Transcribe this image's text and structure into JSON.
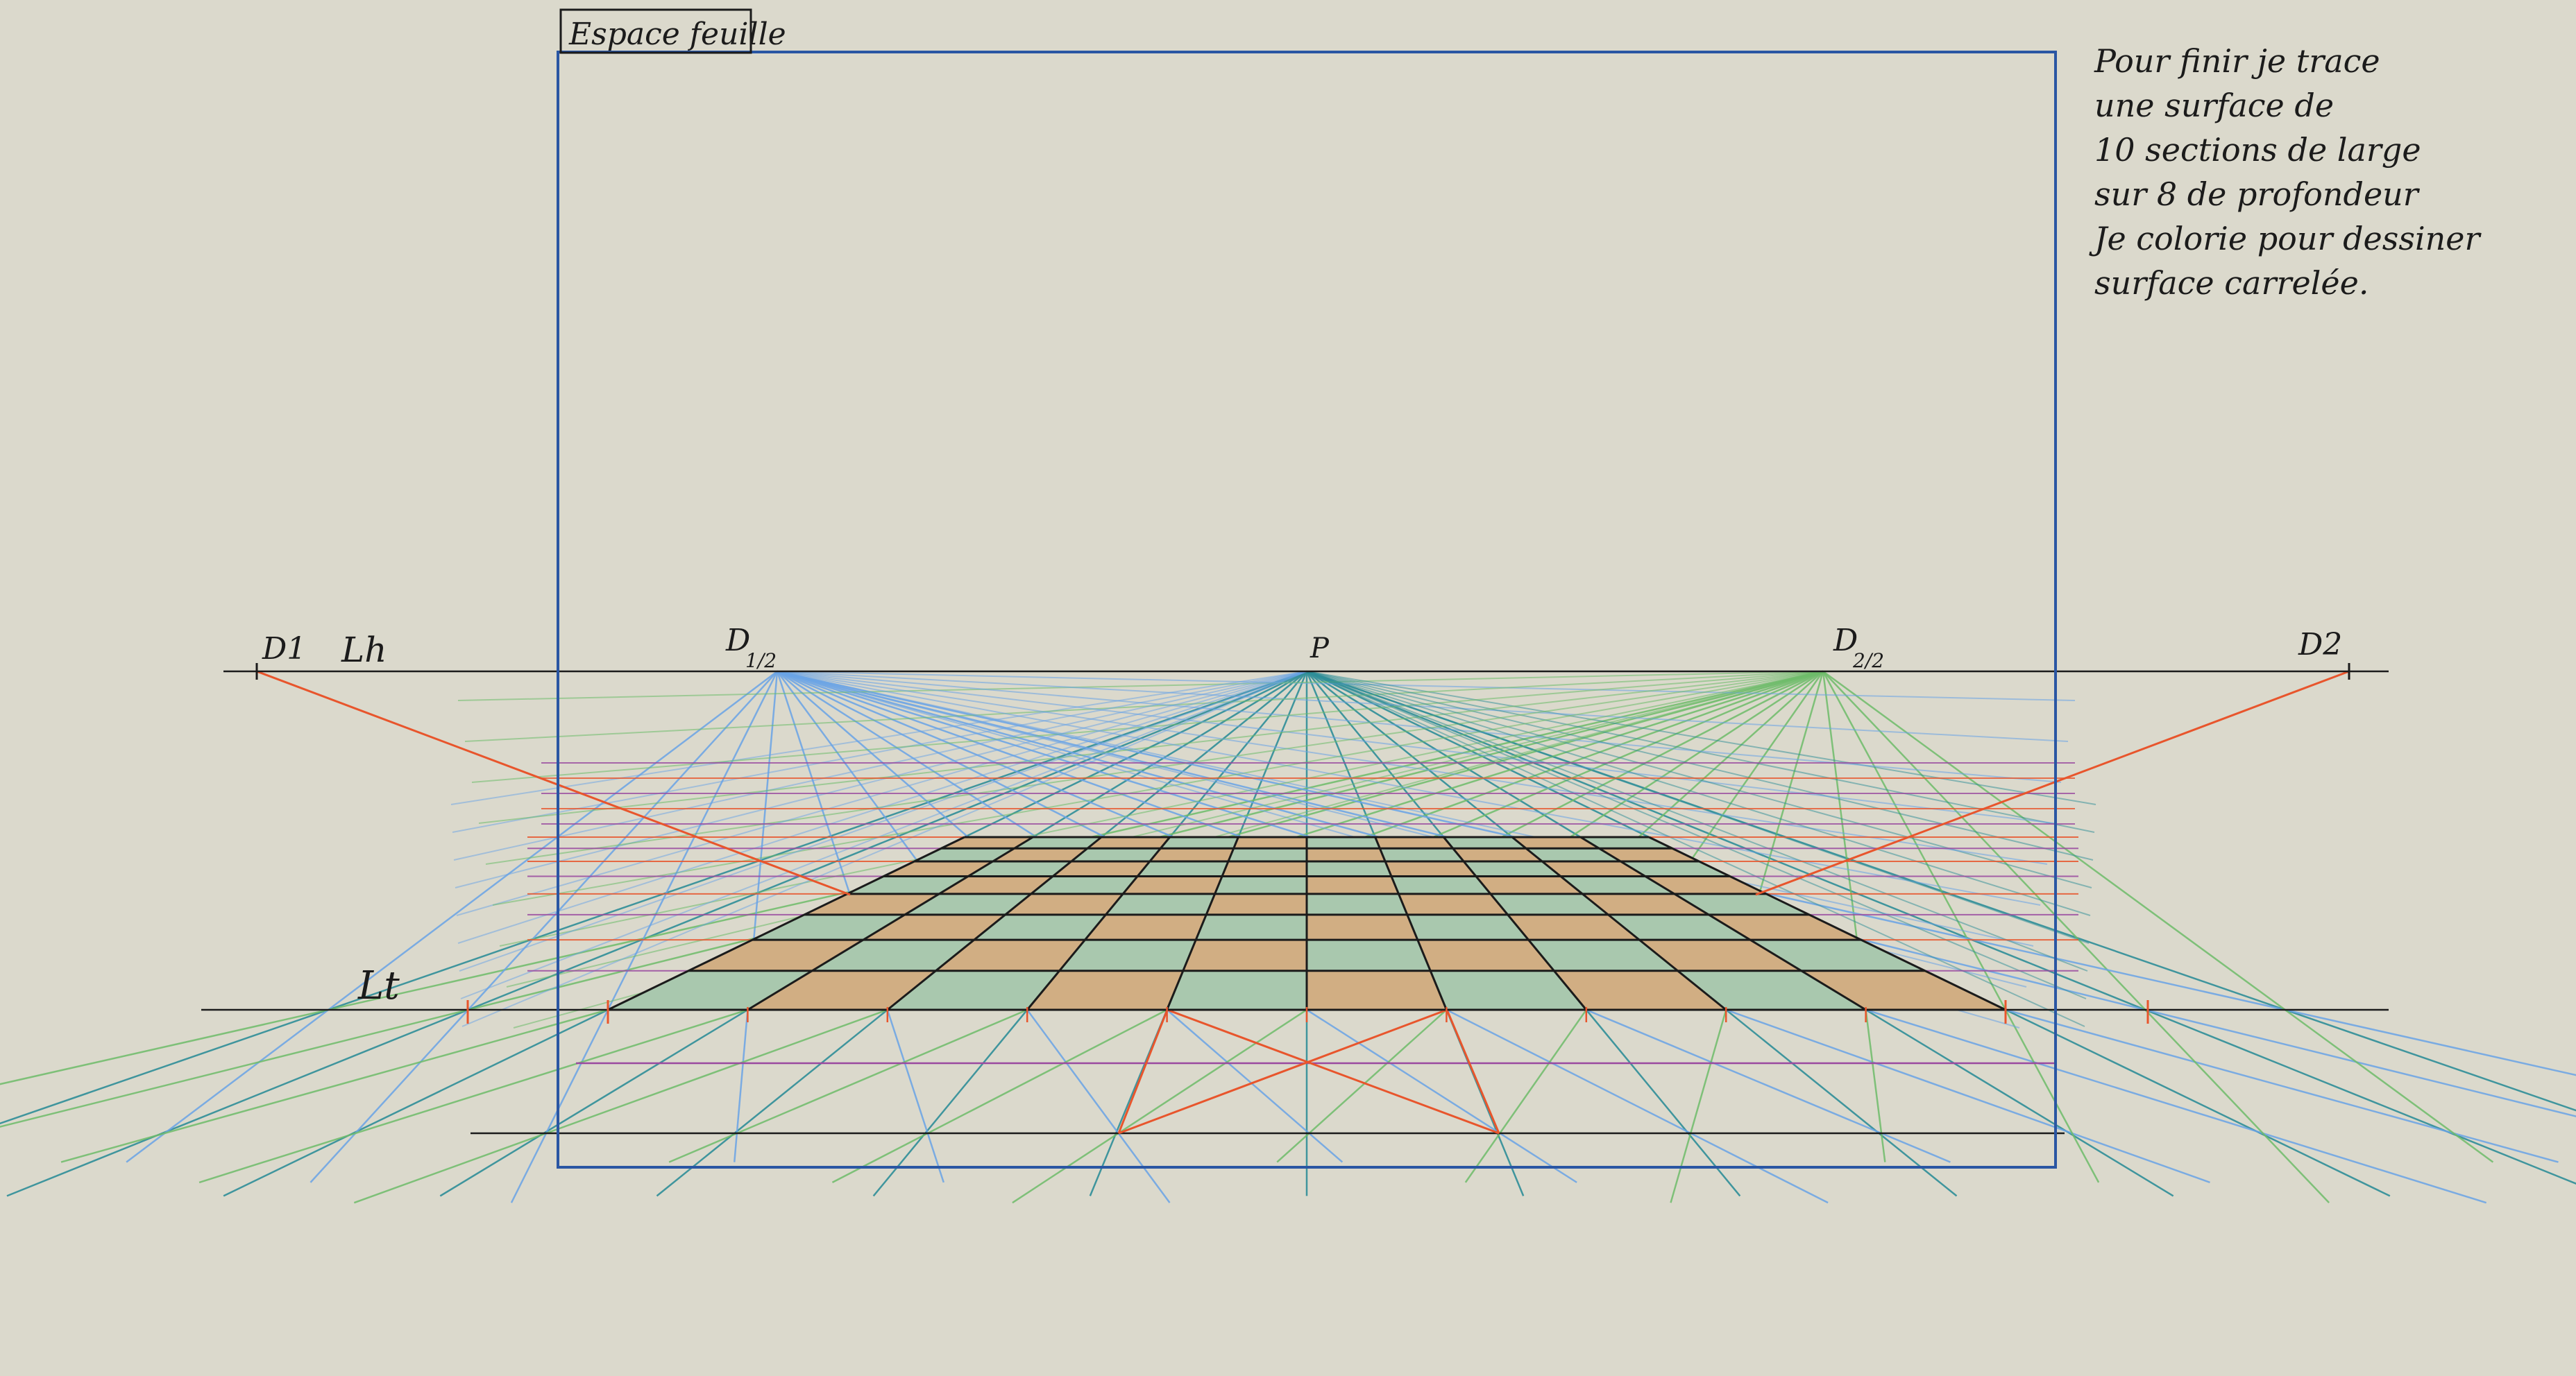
{
  "sheet_label": "Espace feuille",
  "labels": {
    "d1": "D1",
    "lh": "Lh",
    "d1_half_main": "D",
    "d1_half_sub": "1/2",
    "p": "P",
    "d2_half_main": "D",
    "d2_half_sub": "2/2",
    "d2": "D2",
    "lt": "Lt"
  },
  "note_lines": [
    "Pour finir je trace",
    "une surface de",
    "10 sections de large",
    "sur 8 de profondeur",
    "Je colorie pour dessiner",
    "surface carrelée."
  ],
  "grid": {
    "columns": 10,
    "rows": 8
  },
  "colors": {
    "background": "#dbd9cc",
    "frame": "#2a56a3",
    "tile_green": "#a9c8ae",
    "tile_tan": "#d1ae83",
    "line_blue": "#6aa4e6",
    "line_teal": "#2f8e98",
    "line_green": "#6ebc6a",
    "line_red": "#e8552c",
    "line_purple": "#9a4aa0",
    "ink": "#1b1b1b"
  }
}
